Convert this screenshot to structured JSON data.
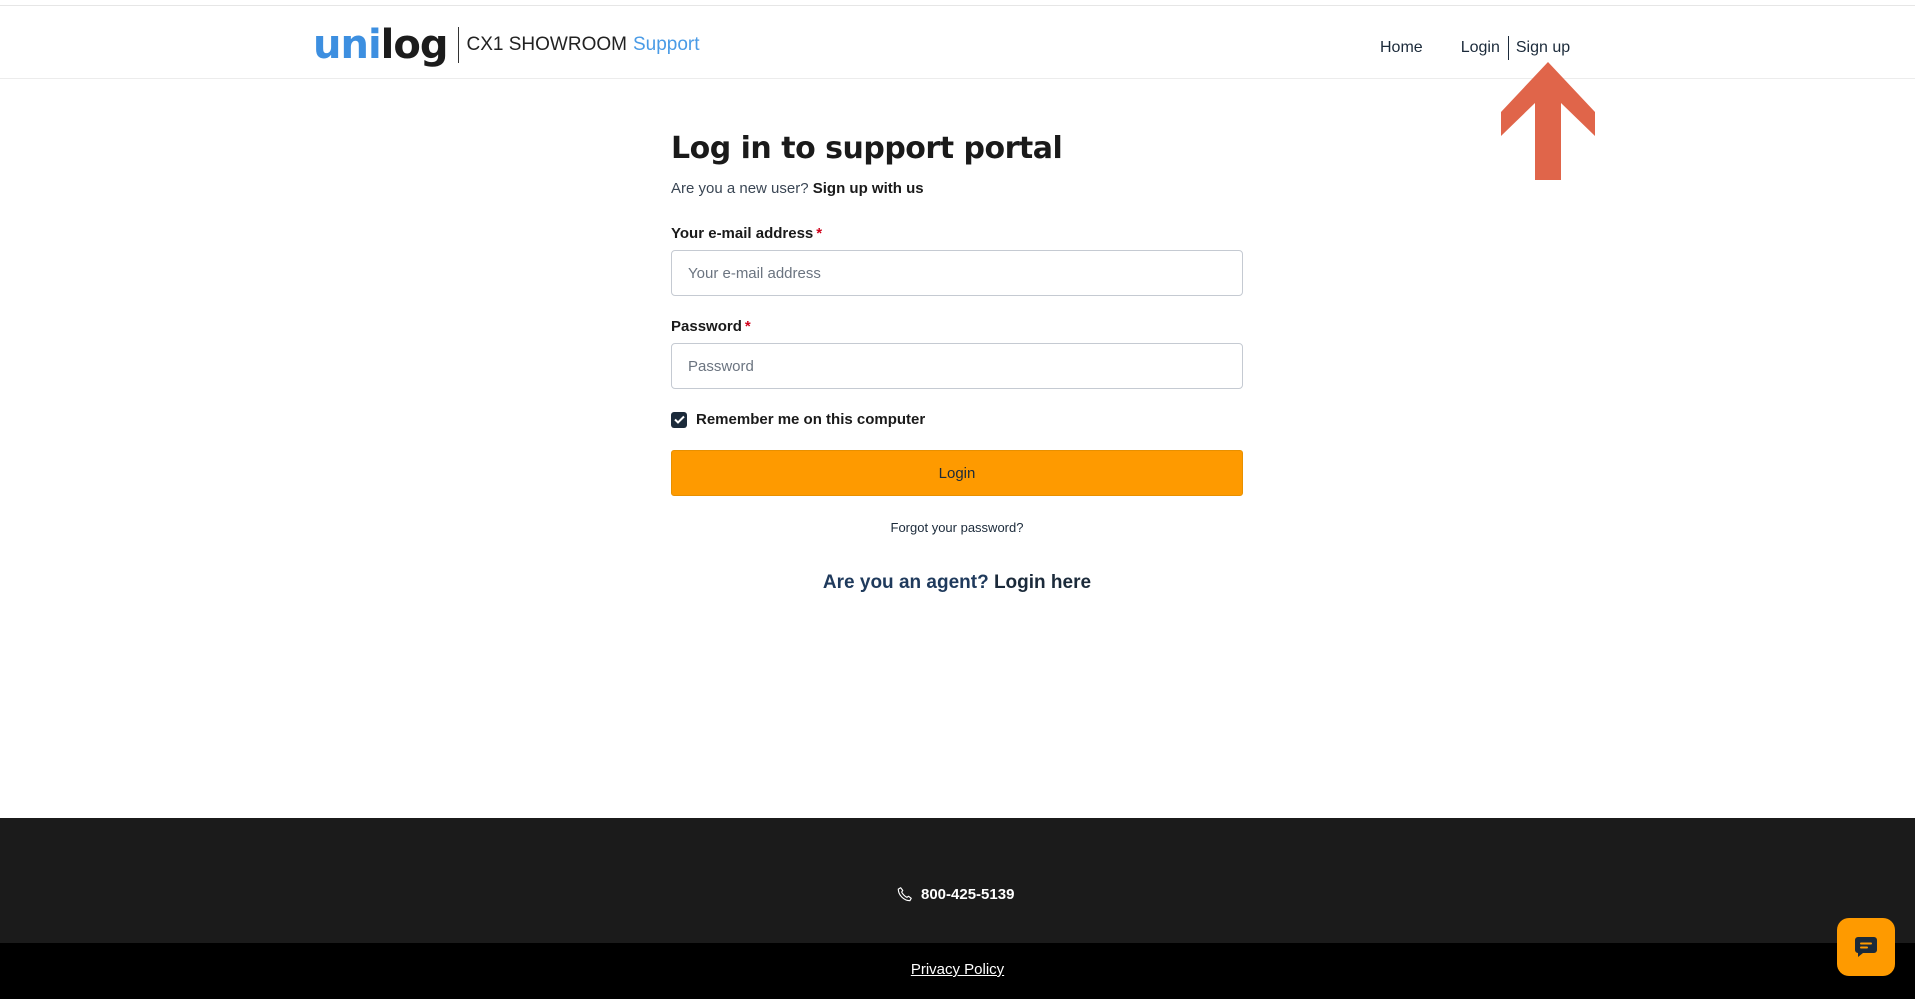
{
  "header": {
    "logo_uni": "uni",
    "logo_log": "log",
    "logo_brand": "CX1 SHOWROOM",
    "logo_support": "Support",
    "nav": {
      "home": "Home",
      "login": "Login",
      "signup": "Sign up"
    }
  },
  "annotation": {
    "arrow_color": "#e0654a",
    "arrow_icon": "arrow-up-icon"
  },
  "form": {
    "title": "Log in to support portal",
    "new_user_text": "Are you a new user?",
    "signup_link": "Sign up with us",
    "email_label": "Your e-mail address",
    "email_placeholder": "Your e-mail address",
    "email_value": "",
    "password_label": "Password",
    "password_placeholder": "Password",
    "password_value": "",
    "required_mark": "*",
    "remember_label": "Remember me on this computer",
    "remember_checked": true,
    "login_button": "Login",
    "forgot_link": "Forgot your password?",
    "agent_text": "Are you an agent?",
    "agent_link": "Login here"
  },
  "footer": {
    "phone": "800-425-5139",
    "phone_icon": "phone-icon",
    "privacy": "Privacy Policy"
  },
  "chat": {
    "icon": "chat-icon"
  },
  "colors": {
    "accent": "#fe9a00",
    "brand_blue": "#3d8fe0",
    "footer_dark": "#1b1b1b",
    "footer_black": "#000000",
    "arrow": "#e0654a"
  }
}
